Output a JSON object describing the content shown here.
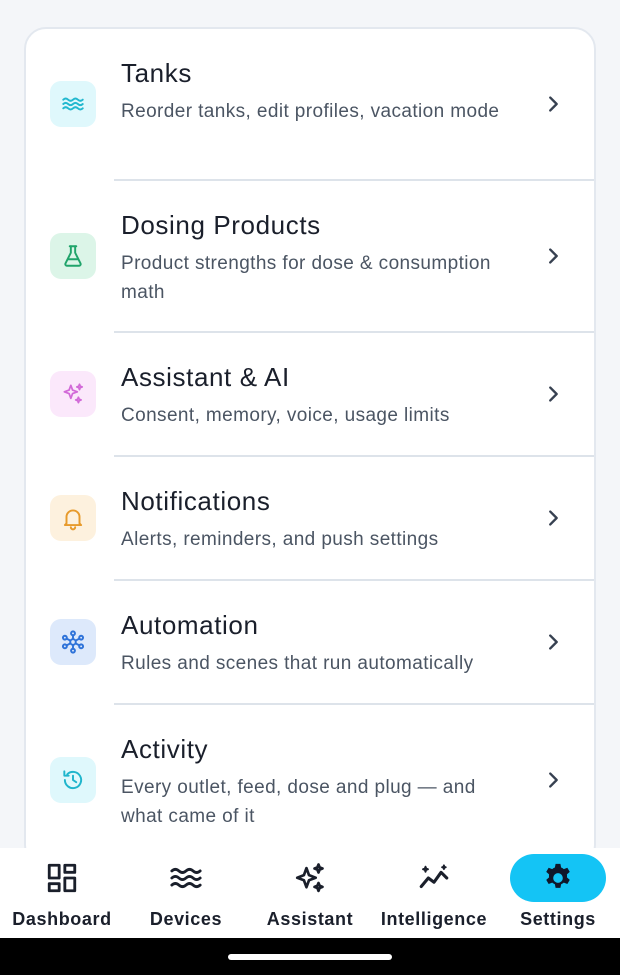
{
  "colors": {
    "accent": "#14c4f5",
    "tanks_icon_bg": "#dff8fc",
    "tanks_icon": "#22b8cf",
    "dosing_icon_bg": "#dcf5e8",
    "dosing_icon": "#20a46b",
    "assistant_icon_bg": "#fbe8fb",
    "assistant_icon": "#d26ad8",
    "notifications_icon_bg": "#fdf1de",
    "notifications_icon": "#e79a2b",
    "automation_icon_bg": "#dde9fb",
    "automation_icon": "#2f73d9",
    "activity_icon_bg": "#dff8fc",
    "activity_icon": "#1fb5cc"
  },
  "settings": {
    "items": [
      {
        "title": "Tanks",
        "description": "Reorder tanks, edit profiles, vacation mode",
        "icon": "waves-icon"
      },
      {
        "title": "Dosing Products",
        "description": "Product strengths for dose & consumption math",
        "icon": "flask-icon"
      },
      {
        "title": "Assistant & AI",
        "description": "Consent, memory, voice, usage limits",
        "icon": "sparkles-icon"
      },
      {
        "title": "Notifications",
        "description": "Alerts, reminders, and push settings",
        "icon": "bell-icon"
      },
      {
        "title": "Automation",
        "description": "Rules and scenes that run automatically",
        "icon": "network-icon"
      },
      {
        "title": "Activity",
        "description": "Every outlet, feed, dose and plug — and what came of it",
        "icon": "history-icon"
      }
    ]
  },
  "nav": {
    "tabs": [
      {
        "label": "Dashboard",
        "icon": "dashboard-icon",
        "active": false
      },
      {
        "label": "Devices",
        "icon": "waves-icon",
        "active": false
      },
      {
        "label": "Assistant",
        "icon": "sparkles-icon",
        "active": false
      },
      {
        "label": "Intelligence",
        "icon": "trend-icon",
        "active": false
      },
      {
        "label": "Settings",
        "icon": "gear-icon",
        "active": true
      }
    ]
  }
}
